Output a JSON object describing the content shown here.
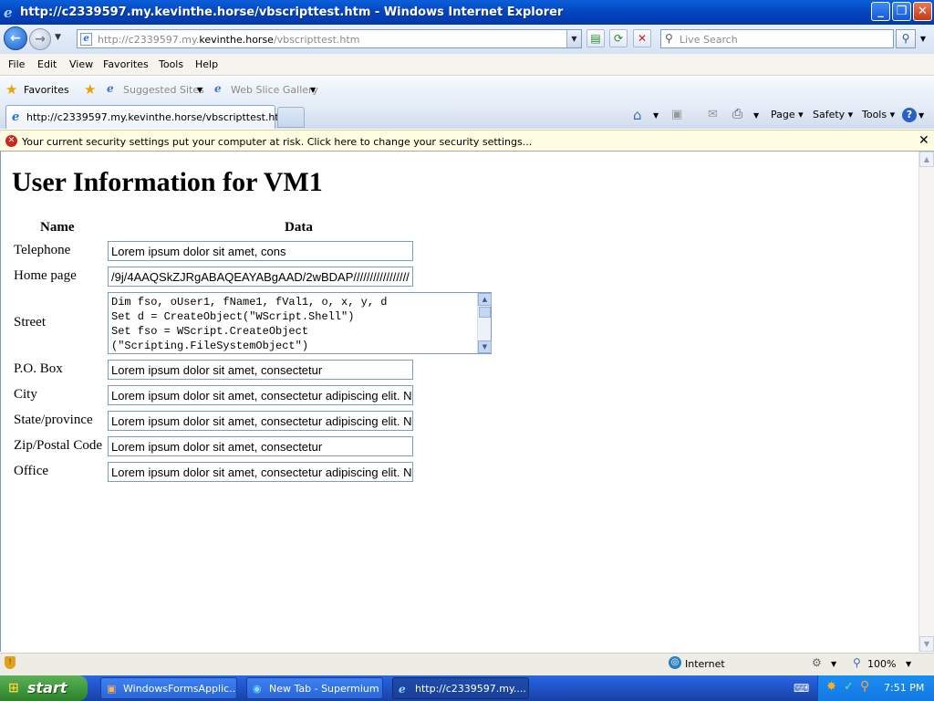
{
  "window": {
    "title": "http://c2339597.my.kevinthe.horse/vbscripttest.htm - Windows Internet Explorer"
  },
  "address_bar": {
    "url_prefix": "http://c2339597.my.",
    "url_domain": "kevinthe.horse",
    "url_suffix": "/vbscripttest.htm"
  },
  "search": {
    "placeholder": "Live Search"
  },
  "menu": [
    "File",
    "Edit",
    "View",
    "Favorites",
    "Tools",
    "Help"
  ],
  "favorites_bar": {
    "favorites_label": "Favorites",
    "suggested_sites": "Suggested Sites",
    "web_slice_gallery": "Web Slice Gallery"
  },
  "tab": {
    "title": "http://c2339597.my.kevinthe.horse/vbscripttest.htm"
  },
  "command_bar": {
    "page": "Page",
    "safety": "Safety",
    "tools": "Tools"
  },
  "info_bar": {
    "message": "Your current security settings put your computer at risk. Click here to change your security settings..."
  },
  "page": {
    "heading": "User Information for VM1",
    "col_name": "Name",
    "col_data": "Data",
    "rows": [
      {
        "label": "Telephone",
        "value": "Lorem ipsum dolor sit amet, cons"
      },
      {
        "label": "Home page",
        "value": "/9j/4AAQSkZJRgABAQEAYABgAAD/2wBDAP/////////////////"
      },
      {
        "label": "Street",
        "value": "Dim fso, oUser1, fName1, fVal1, o, x, y, d\nSet d = CreateObject(\"WScript.Shell\")\nSet fso = WScript.CreateObject\n(\"Scripting.FileSystemObject\")"
      },
      {
        "label": "P.O. Box",
        "value": "Lorem ipsum dolor sit amet, consectetur"
      },
      {
        "label": "City",
        "value": "Lorem ipsum dolor sit amet, consectetur adipiscing elit. N"
      },
      {
        "label": "State/province",
        "value": "Lorem ipsum dolor sit amet, consectetur adipiscing elit. N"
      },
      {
        "label": "Zip/Postal Code",
        "value": "Lorem ipsum dolor sit amet, consectetur"
      },
      {
        "label": "Office",
        "value": "Lorem ipsum dolor sit amet, consectetur adipiscing elit. N"
      }
    ]
  },
  "status_bar": {
    "zone": "Internet",
    "zoom": "100%"
  },
  "taskbar": {
    "start_label": "start",
    "tasks": [
      {
        "label": "WindowsFormsApplic..."
      },
      {
        "label": "New Tab - Supermium"
      },
      {
        "label": "http://c2339597.my...."
      }
    ],
    "clock": "7:51 PM"
  },
  "colors": {
    "title_bar": "#0a5fd8",
    "info_bar": "#fffde1",
    "taskbar": "#245edb",
    "start_button": "#3c9639"
  }
}
